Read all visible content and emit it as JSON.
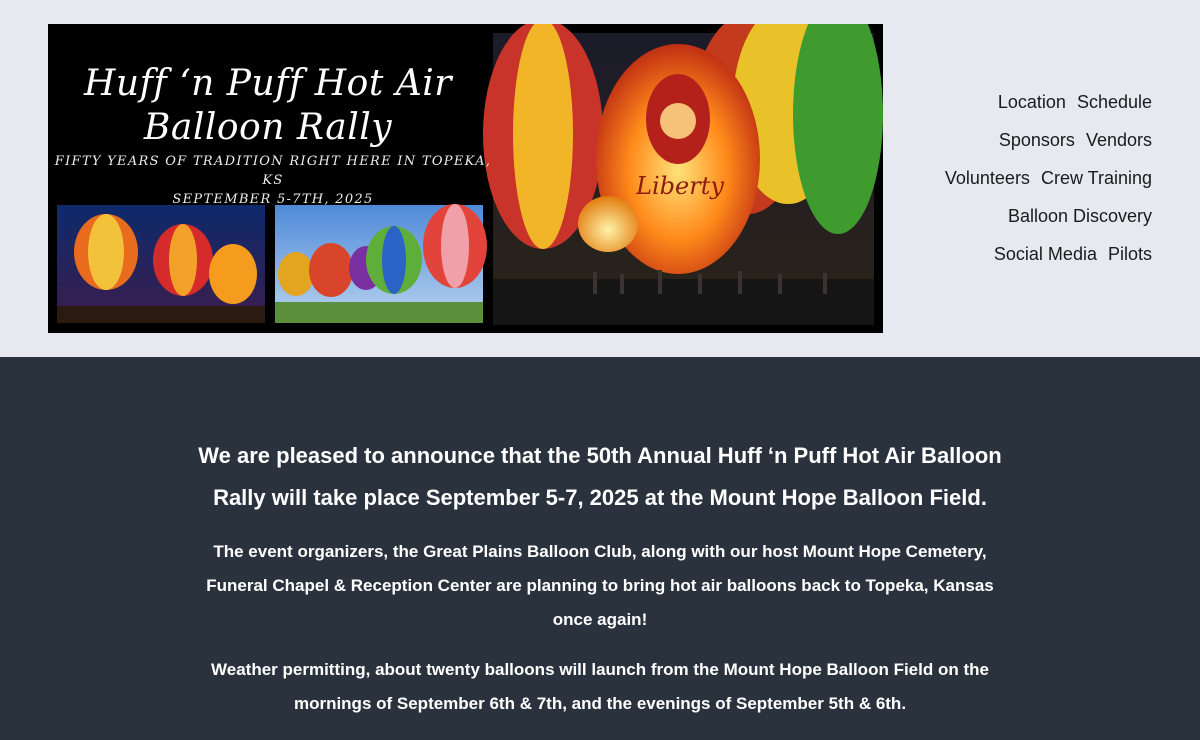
{
  "banner": {
    "title_line1": "Huff ‘n Puff Hot Air",
    "title_line2": "Balloon Rally",
    "subtitle_line1": "FIFTY YEARS OF TRADITION RIGHT HERE IN TOPEKA, KS",
    "subtitle_line2": "SEPTEMBER 5-7TH, 2025",
    "balloon_text": "Liberty"
  },
  "nav": {
    "location": "Location",
    "schedule": "Schedule",
    "sponsors": "Sponsors",
    "vendors": "Vendors",
    "volunteers": "Volunteers",
    "crew_training": "Crew Training",
    "balloon_discovery": "Balloon Discovery",
    "social_media": "Social Media",
    "pilots": "Pilots"
  },
  "main": {
    "headline_line1": "We are pleased to announce that the 50th Annual Huff ‘n Puff Hot Air Balloon",
    "headline_line2": "Rally will take place September 5-7, 2025 at the Mount Hope Balloon Field.",
    "para1_line1": "The event organizers, the Great Plains Balloon Club, along with our host Mount Hope Cemetery,",
    "para1_line2": "Funeral Chapel & Reception Center are planning to bring hot air balloons back to Topeka, Kansas",
    "para1_line3": "once again!",
    "para2_line1": "Weather permitting, about twenty balloons will launch from the Mount Hope Balloon Field on the",
    "para2_line2": "mornings of September 6th & 7th, and the evenings of September 5th & 6th."
  },
  "colors": {
    "header_bg": "#e8e8f1",
    "main_bg": "#2a333d",
    "text_light": "#ffffff",
    "nav_text": "#1b1b1b"
  }
}
